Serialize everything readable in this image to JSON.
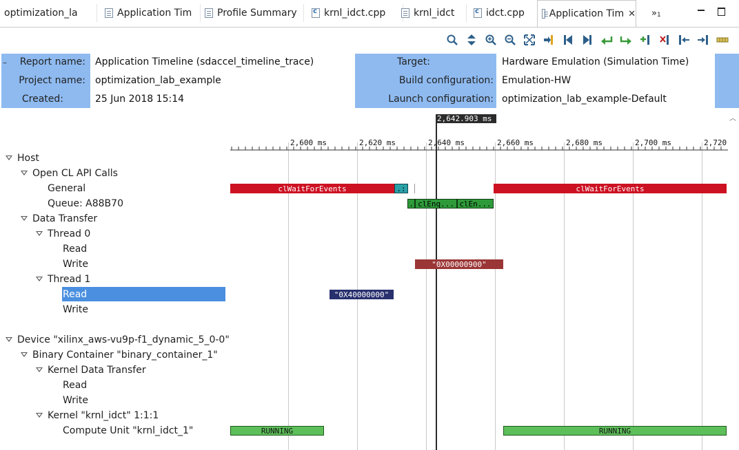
{
  "tabs": [
    {
      "label": "optimization_la",
      "icon": "project-icon"
    },
    {
      "label": "Application Tim",
      "icon": "document-icon"
    },
    {
      "label": "Profile Summary",
      "icon": "document-icon"
    },
    {
      "label": "krnl_idct.cpp",
      "icon": "cpp-file-icon"
    },
    {
      "label": "krnl_idct",
      "icon": "document-icon"
    },
    {
      "label": "idct.cpp",
      "icon": "cpp-file-icon"
    },
    {
      "label": "Application Tim",
      "icon": "document-icon",
      "active": true,
      "close": "✕"
    }
  ],
  "overflow": {
    "label": "»",
    "count": "1"
  },
  "window_controls": {
    "minimize": "▭",
    "maximize": "☐"
  },
  "toolbar_icons": [
    "find-icon",
    "expand-collapse-icon",
    "zoom-in-icon",
    "zoom-out-icon",
    "zoom-fit-icon",
    "add-marker-icon",
    "first-icon",
    "last-icon",
    "previous-event-icon",
    "next-event-icon",
    "add-marker-icon",
    "remove-marker-icon",
    "previous-marker-icon",
    "next-marker-icon",
    "legend-icon"
  ],
  "header": {
    "collapse": "–",
    "report_name_label": "Report name:",
    "report_name": "Application Timeline (sdaccel_timeline_trace)",
    "project_name_label": "Project name:",
    "project_name": "optimization_lab_example",
    "created_label": "Created:",
    "created": "25 Jun 2018 15:14",
    "target_label": "Target:",
    "target": "Hardware Emulation (Simulation Time)",
    "build_label": "Build configuration:",
    "build": "Emulation-HW",
    "launch_label": "Launch configuration:",
    "launch": "optimization_lab_example-Default"
  },
  "cursor": {
    "time_label": "2,642.903 ms"
  },
  "time_axis": {
    "ticks": [
      "2,600 ms",
      "2,620 ms",
      "2,640 ms",
      "2,660 ms",
      "2,680 ms",
      "2,700 ms",
      "2,720"
    ]
  },
  "tree": {
    "host": "Host",
    "opencl_api_calls": "Open CL API Calls",
    "general": "General",
    "queue": "Queue: A88B70",
    "data_transfer": "Data Transfer",
    "thread0": "Thread 0",
    "thread0_read": "Read",
    "thread0_write": "Write",
    "thread1": "Thread 1",
    "thread1_read": "Read",
    "thread1_write": "Write",
    "device": "Device \"xilinx_aws-vu9p-f1_dynamic_5_0-0\"",
    "binary_container": "Binary Container \"binary_container_1\"",
    "kernel_data_transfer": "Kernel Data Transfer",
    "kdt_read": "Read",
    "kdt_write": "Write",
    "kernel": "Kernel \"krnl_idct\" 1:1:1",
    "compute_unit": "Compute Unit \"krnl_idct_1\""
  },
  "events": {
    "general_left": "clWaitForEvents",
    "general_small": ".:",
    "general_right": "clWaitForEvents",
    "queue_a": ".",
    "queue_b": "clEnq...",
    "queue_c": "clEn...",
    "t0_write": "\"0X00000900\"",
    "t1_read": "\"0X40000000\"",
    "cu_running_1": "RUNNING",
    "cu_running_2": "RUNNING"
  },
  "colors": {
    "api_red": "#cc1122",
    "queue_green": "#2e9a3a",
    "write_brown": "#9b3636",
    "read_navy": "#28306e",
    "running_green": "#5dbf5a",
    "header_blue": "#8ebaf0",
    "selection_blue": "#4a8fe0"
  }
}
